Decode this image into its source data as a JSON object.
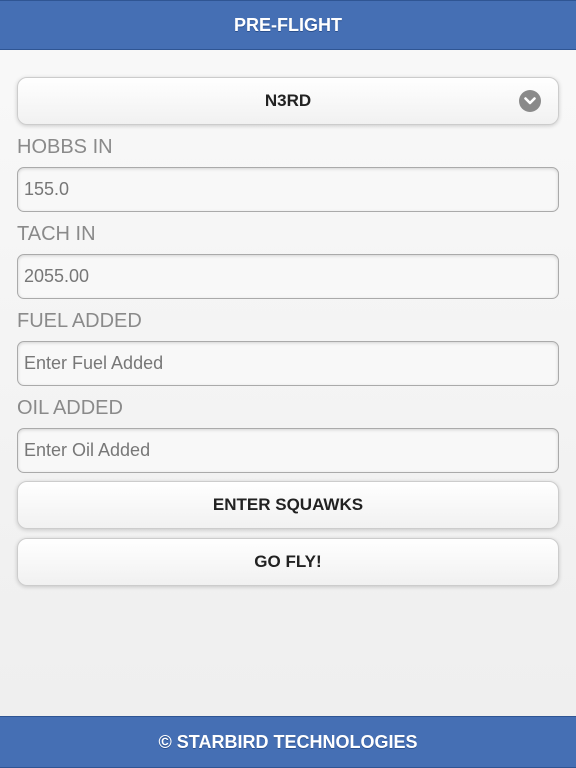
{
  "header": {
    "title": "PRE-FLIGHT"
  },
  "aircraft_select": {
    "selected": "N3RD",
    "icon": "chevron-down-icon"
  },
  "fields": [
    {
      "label": "HOBBS IN",
      "value": "155.0",
      "placeholder": ""
    },
    {
      "label": "TACH IN",
      "value": "2055.00",
      "placeholder": ""
    },
    {
      "label": "FUEL ADDED",
      "value": "",
      "placeholder": "Enter Fuel Added"
    },
    {
      "label": "OIL ADDED",
      "value": "",
      "placeholder": "Enter Oil Added"
    }
  ],
  "buttons": {
    "enter_squawks": "ENTER SQUAWKS",
    "go_fly": "GO FLY!"
  },
  "footer": {
    "text": "© STARBIRD TECHNOLOGIES"
  },
  "colors": {
    "bar_blue": "#456fb4",
    "label_gray": "#8a8a8a"
  }
}
